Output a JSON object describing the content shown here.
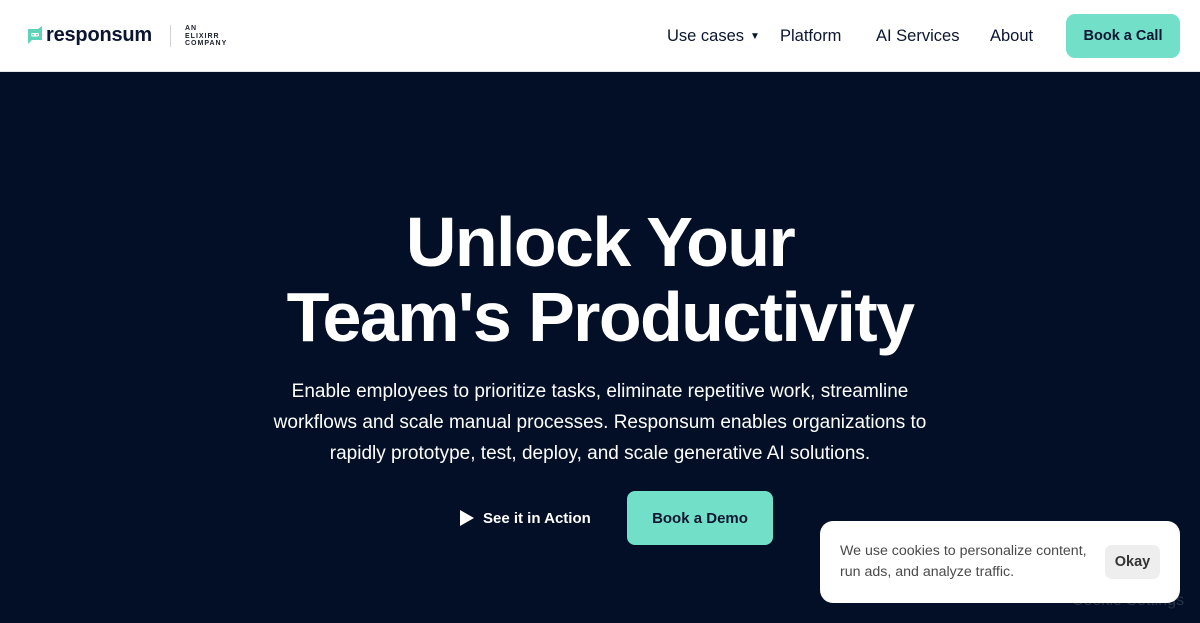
{
  "header": {
    "logo": {
      "wordmark": "responsum",
      "tagline_lines": [
        "AN",
        "ELIXIRR",
        "COMPANY"
      ],
      "icon": "chat-bubble-bot-icon",
      "icon_color": "#5fd3b8"
    },
    "nav": [
      {
        "label": "Use cases",
        "has_dropdown": true
      },
      {
        "label": "Platform"
      },
      {
        "label": "AI Services"
      },
      {
        "label": "About"
      }
    ],
    "cta_label": "Book a Call"
  },
  "hero": {
    "title_line1": "Unlock Your",
    "title_line2": "Team's Productivity",
    "subtitle": "Enable employees to prioritize tasks, eliminate repetitive work, streamline workflows and scale manual processes. Responsum enables organizations to rapidly prototype, test, deploy, and scale generative AI solutions.",
    "secondary_cta": {
      "label": "See it in Action",
      "icon": "play-icon"
    },
    "primary_cta": {
      "label": "Book a Demo"
    }
  },
  "cookie_banner": {
    "text": "We use cookies to personalize content, run ads, and analyze traffic.",
    "accept_label": "Okay",
    "settings_label": "Cookie Settings"
  },
  "colors": {
    "accent": "#72e0c9",
    "hero_bg": "#020f26",
    "ink": "#0b1530"
  }
}
